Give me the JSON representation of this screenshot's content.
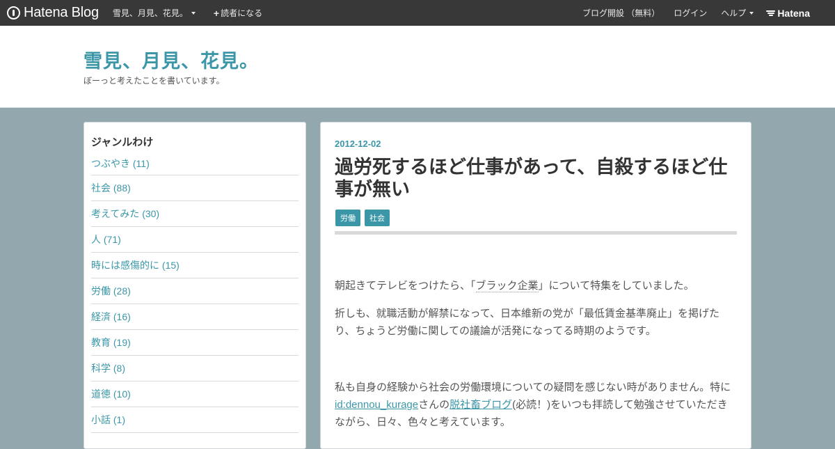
{
  "globalbar": {
    "logo": "Hatena Blog",
    "blog_menu": "雪見、月見、花見。",
    "subscribe": "読者になる",
    "signup": "ブログ開設 （無料）",
    "login": "ログイン",
    "help": "ヘルプ",
    "hatena": "Hatena"
  },
  "header": {
    "title": "雪見、月見、花見。",
    "description": "ぼーっと考えたことを書いています。"
  },
  "sidebar": {
    "title": "ジャンルわけ",
    "categories": [
      "つぶやき (11)",
      "社会 (88)",
      "考えてみた (30)",
      "人 (71)",
      "時には感傷的に (15)",
      "労働 (28)",
      "経済 (16)",
      "教育 (19)",
      "科学 (8)",
      "道徳 (10)",
      "小話 (1)"
    ]
  },
  "entry": {
    "date": "2012-12-02",
    "title": "過労死するほど仕事があって、自殺するほど仕事が無い",
    "tags": [
      "労働",
      "社会"
    ],
    "p1_a": "朝起きてテレビをつけたら、「",
    "p1_kw": "ブラック企業",
    "p1_b": "」について特集をしていました。",
    "p2": "折しも、就職活動が解禁になって、日本維新の党が「最低賃金基準廃止」を掲げたり、ちょうど労働に関しての議論が活発になってる時期のようです。",
    "p3_a": "私も自身の経験から社会の労働環境についての疑問を感じない時がありません。特に",
    "p3_link1": "id:dennou_kurage",
    "p3_b": "さんの",
    "p3_link2": "脱社畜ブログ",
    "p3_c": "(必読！)をいつも拝読して勉強させていただきながら、日々、色々と考えています。"
  },
  "colors": {
    "accent": "#3b97a8",
    "globalbar_bg": "#383838",
    "page_bg": "#93a7ae"
  }
}
